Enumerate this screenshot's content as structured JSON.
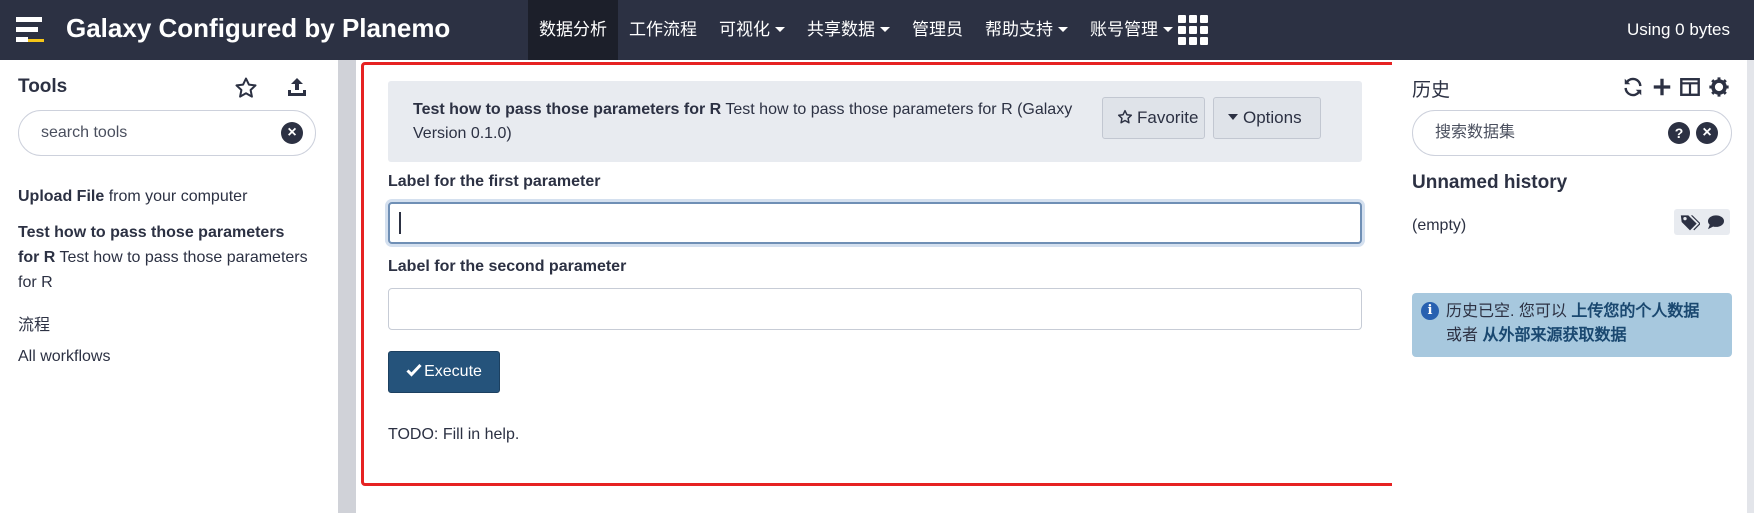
{
  "app": {
    "title": "Galaxy Configured by Planemo",
    "usage": "Using 0 bytes"
  },
  "nav": {
    "items": [
      {
        "label": "数据分析",
        "active": true,
        "dropdown": false
      },
      {
        "label": "工作流程",
        "active": false,
        "dropdown": false
      },
      {
        "label": "可视化",
        "active": false,
        "dropdown": true
      },
      {
        "label": "共享数据",
        "active": false,
        "dropdown": true
      },
      {
        "label": "管理员",
        "active": false,
        "dropdown": false
      },
      {
        "label": "帮助支持",
        "active": false,
        "dropdown": true
      },
      {
        "label": "账号管理",
        "active": false,
        "dropdown": true
      }
    ]
  },
  "tools_panel": {
    "title": "Tools",
    "search_placeholder": "search tools",
    "upload": {
      "name": "Upload File",
      "desc": "from your computer"
    },
    "test_tool": {
      "name": "Test how to pass those parameters for R",
      "desc": "Test how to pass those parameters for R"
    },
    "workflows_heading": "流程",
    "all_workflows": "All workflows"
  },
  "tool_form": {
    "name": "Test how to pass those parameters for R",
    "desc": "Test how to pass those parameters for R (Galaxy Version 0.1.0)",
    "favorite_label": "Favorite",
    "options_label": "Options",
    "param1_label": "Label for the first parameter",
    "param1_value": "",
    "param2_label": "Label for the second parameter",
    "param2_value": "",
    "execute_label": "Execute",
    "help": "TODO: Fill in help."
  },
  "history": {
    "title": "历史",
    "search_placeholder": "搜索数据集",
    "name": "Unnamed history",
    "empty": "(empty)",
    "info_prefix": "历史已空. 您可以 ",
    "info_upload_link": "上传您的个人数据",
    "info_or": " 或者 ",
    "info_external_link": "从外部来源获取数据"
  },
  "colors": {
    "masthead": "#2c3143",
    "primary_button": "#25537b",
    "info_box": "#a7c8de",
    "highlight_frame": "#e62222"
  }
}
